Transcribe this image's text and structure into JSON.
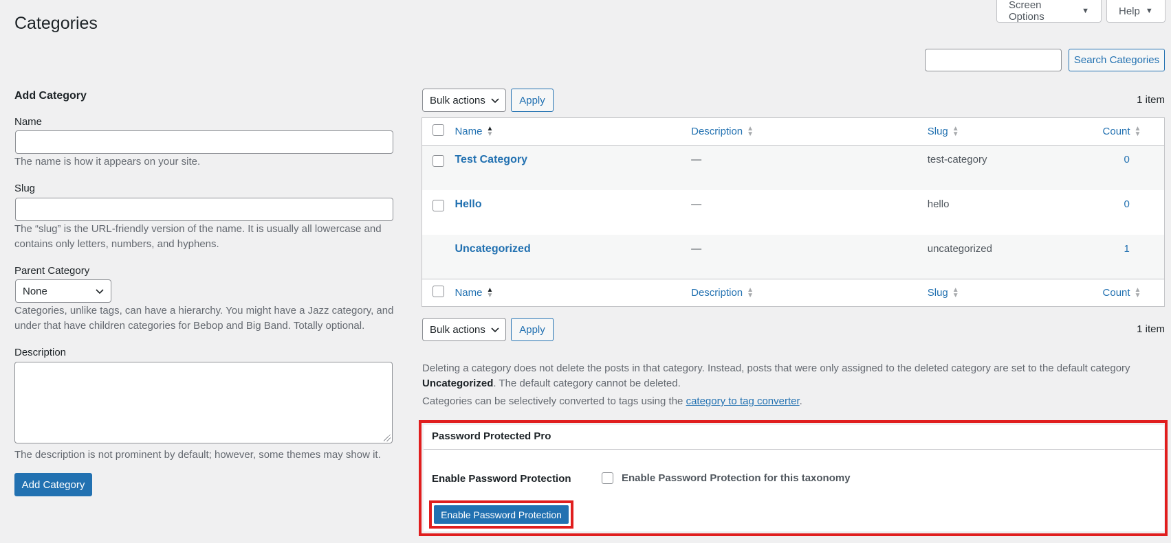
{
  "header": {
    "screen_options": "Screen Options",
    "help": "Help",
    "page_title": "Categories"
  },
  "search": {
    "value": "",
    "button": "Search Categories"
  },
  "add_form": {
    "heading": "Add Category",
    "name_label": "Name",
    "name_help": "The name is how it appears on your site.",
    "slug_label": "Slug",
    "slug_help_1": "The “slug” is the URL-friendly version of the name. It is usually all lowercase and",
    "slug_help_2": "contains only letters, numbers, and hyphens.",
    "parent_label": "Parent Category",
    "parent_selected": "None",
    "parent_help_1": "Categories, unlike tags, can have a hierarchy. You might have a Jazz category, and",
    "parent_help_2": "under that have children categories for Bebop and Big Band. Totally optional.",
    "description_label": "Description",
    "description_help": "The description is not prominent by default; however, some themes may show it.",
    "submit": "Add Category"
  },
  "table_nav": {
    "bulk_actions": "Bulk actions",
    "apply": "Apply",
    "item_count": "1 item"
  },
  "table": {
    "columns": {
      "name": "Name",
      "description": "Description",
      "slug": "Slug",
      "count": "Count"
    },
    "rows": [
      {
        "name": "Test Category",
        "description": "—",
        "slug": "test-category",
        "count": "0"
      },
      {
        "name": "Hello",
        "description": "—",
        "slug": "hello",
        "count": "0"
      },
      {
        "name": "Uncategorized",
        "description": "—",
        "slug": "uncategorized",
        "count": "1"
      }
    ]
  },
  "notes": {
    "delete_1": "Deleting a category does not delete the posts in that category. Instead, posts that were only assigned to the deleted category are set to the default category",
    "delete_bold": "Uncategorized",
    "delete_2": ". The default category cannot be deleted.",
    "convert_pre": "Categories can be selectively converted to tags using the",
    "convert_link": "category to tag converter",
    "convert_post": "."
  },
  "password_panel": {
    "title": "Password Protected Pro",
    "label": "Enable Password Protection",
    "checkbox_text": "Enable Password Protection for this taxonomy",
    "button": "Enable Password Protection"
  },
  "colors": {
    "accent": "#2271b1",
    "highlight": "#e01e1e",
    "background": "#f0f0f1"
  }
}
